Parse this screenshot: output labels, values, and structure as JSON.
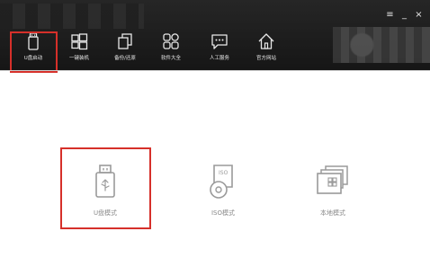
{
  "window_controls": {
    "menu": "≡",
    "minimize": "_",
    "close": "×"
  },
  "nav": [
    {
      "label": "U盘启动",
      "icon": "usb-drive-icon",
      "active": true
    },
    {
      "label": "一键装机",
      "icon": "windows-logo-icon",
      "active": false
    },
    {
      "label": "备份/还原",
      "icon": "backup-restore-icon",
      "active": false
    },
    {
      "label": "软件大全",
      "icon": "apps-grid-icon",
      "active": false
    },
    {
      "label": "人工服务",
      "icon": "chat-bubble-icon",
      "active": false
    },
    {
      "label": "官方网站",
      "icon": "home-icon",
      "active": false
    }
  ],
  "modes": [
    {
      "label": "U盘模式",
      "icon": "usb-drive-icon",
      "selected": true
    },
    {
      "label": "ISO模式",
      "icon": "iso-disc-icon",
      "selected": false
    },
    {
      "label": "本地模式",
      "icon": "local-windows-icon",
      "selected": false
    }
  ],
  "colors": {
    "highlight": "#d6302a",
    "topbar": "#1e1e1e",
    "icon_gray": "#9a9a9a"
  }
}
